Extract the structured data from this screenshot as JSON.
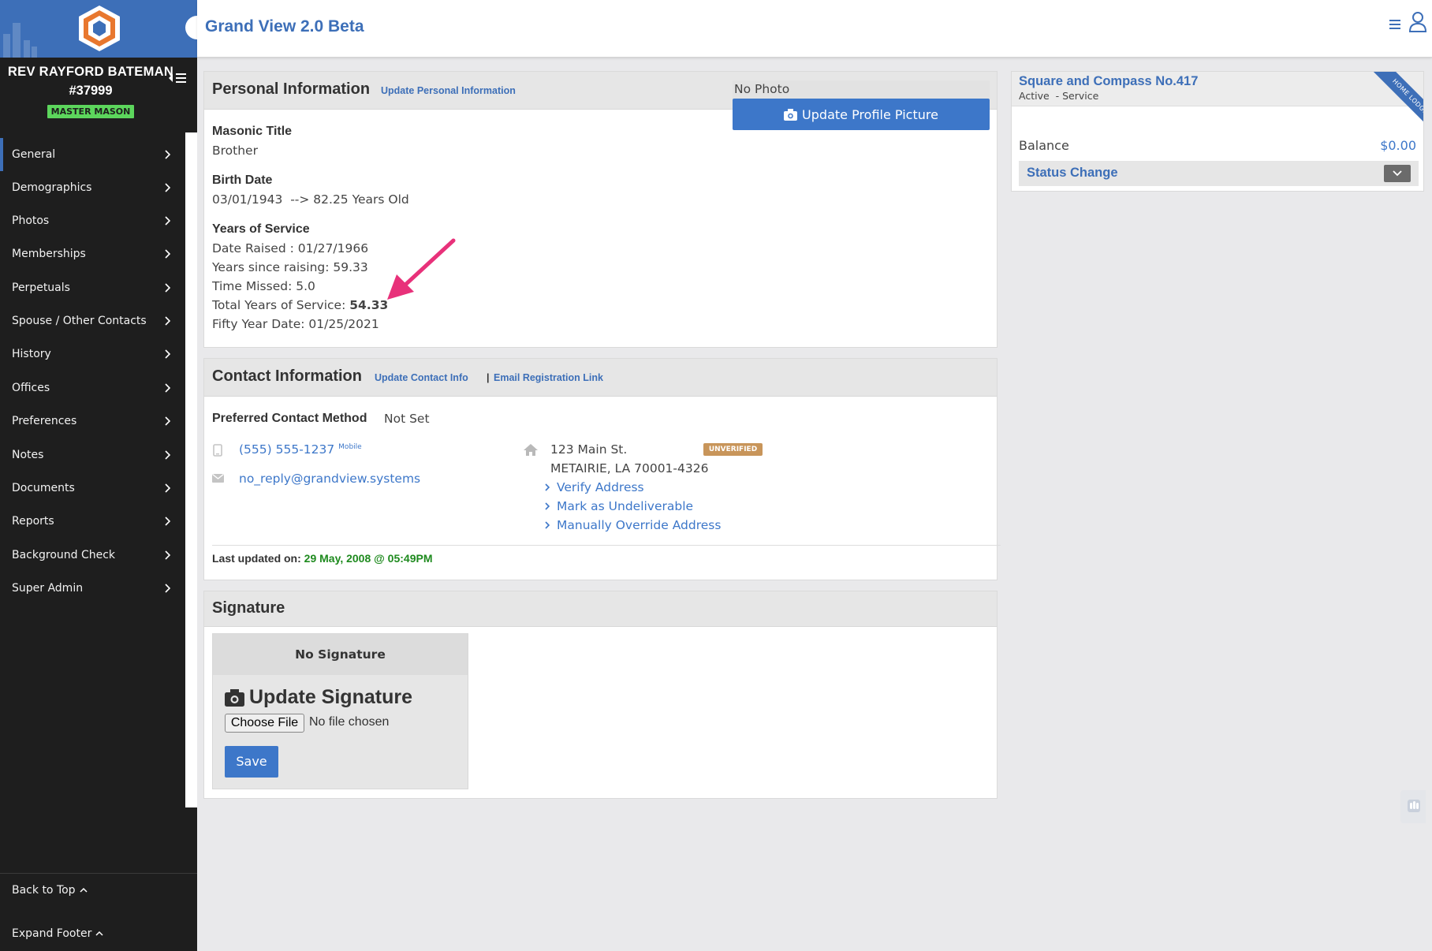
{
  "app": {
    "title": "Grand View 2.0 Beta"
  },
  "user": {
    "name": "REV RAYFORD BATEMAN",
    "number": "#37999",
    "rank": "MASTER MASON"
  },
  "nav": {
    "items": [
      {
        "label": "General"
      },
      {
        "label": "Demographics"
      },
      {
        "label": "Photos"
      },
      {
        "label": "Memberships"
      },
      {
        "label": "Perpetuals"
      },
      {
        "label": "Spouse / Other Contacts"
      },
      {
        "label": "History"
      },
      {
        "label": "Offices"
      },
      {
        "label": "Preferences"
      },
      {
        "label": "Notes"
      },
      {
        "label": "Documents"
      },
      {
        "label": "Reports"
      },
      {
        "label": "Background Check"
      },
      {
        "label": "Super Admin"
      }
    ],
    "back_to_top": "Back to Top",
    "expand_footer": "Expand Footer"
  },
  "personal": {
    "title": "Personal Information",
    "update_link": "Update Personal Information",
    "masonic_title_label": "Masonic Title",
    "masonic_title": "Brother",
    "birth_date_label": "Birth Date",
    "birth_date": "03/01/1943  --> 82.25 Years Old",
    "service_label": "Years of Service",
    "date_raised": "Date Raised : 01/27/1966",
    "years_since_raising": "Years since raising: 59.33",
    "time_missed": "Time Missed: 5.0",
    "total_years_label": "Total Years of Service:",
    "total_years_value": "54.33",
    "fifty_year_date": "Fifty Year Date: 01/25/2021",
    "no_photo": "No Photo",
    "update_photo_button": "Update Profile Picture"
  },
  "contact": {
    "title": "Contact Information",
    "update_link": "Update Contact Info",
    "separator": "|",
    "email_link": "Email Registration Link",
    "preferred_label": "Preferred Contact Method",
    "preferred_value": "Not Set",
    "phone": "(555) 555-1237",
    "phone_type": "Mobile",
    "email": "no_reply@grandview.systems",
    "address_line1": "123 Main St.",
    "address_line2": "METAIRIE, LA 70001-4326",
    "address_badge": "UNVERIFIED",
    "actions": [
      {
        "label": "Verify Address"
      },
      {
        "label": "Mark as Undeliverable"
      },
      {
        "label": "Manually Override Address"
      }
    ],
    "last_updated_label": "Last updated on:",
    "last_updated_value": "29 May, 2008 @ 05:49PM"
  },
  "signature": {
    "title": "Signature",
    "no_signature": "No Signature",
    "update_title": "Update Signature",
    "choose_file": "Choose File",
    "file_status": "No file chosen",
    "save": "Save"
  },
  "lodge": {
    "name": "Square and Compass No.417",
    "status": "Active  - Service",
    "ribbon": "HOME LODGE",
    "balance_label": "Balance",
    "balance_value": "$0.00",
    "status_change": "Status Change"
  },
  "colors": {
    "brand": "#3d6fb8",
    "sidebar": "#1e1e1e",
    "badge_green": "#5cd65c",
    "arrow": "#e8317a",
    "date_green": "#1e8a1e",
    "unverified": "#c8955a"
  },
  "icons": [
    "logo-icon",
    "collapse-icon",
    "menu-icon",
    "user-icon",
    "chevron-right-icon",
    "camera-icon",
    "phone-icon",
    "mail-icon",
    "home-icon",
    "chevron-down-icon",
    "chevron-up-icon",
    "hand-icon",
    "annotation-arrow"
  ]
}
